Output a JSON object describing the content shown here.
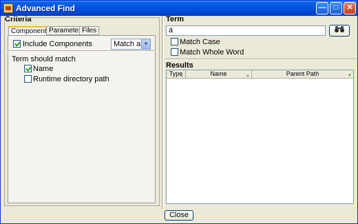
{
  "window": {
    "title": "Advanced Find",
    "buttons": {
      "minimize": "—",
      "maximize": "□",
      "close": "✕"
    }
  },
  "criteria": {
    "title": "Criteria",
    "tabs": [
      {
        "label": "Components",
        "active": true
      },
      {
        "label": "Parameters",
        "active": false
      },
      {
        "label": "Files",
        "active": false
      }
    ],
    "include_components": {
      "label": "Include Components",
      "checked": true
    },
    "match_select": {
      "value": "Match any"
    },
    "term_should_match": "Term should match",
    "options": [
      {
        "label": "Name",
        "checked": true
      },
      {
        "label": "Runtime directory path",
        "checked": false
      }
    ]
  },
  "term": {
    "title": "Term",
    "input_value": "a",
    "find_icon": "binoculars-icon",
    "match_case": {
      "label": "Match Case",
      "checked": false
    },
    "match_whole_word": {
      "label": "Match Whole Word",
      "checked": false
    }
  },
  "results": {
    "title": "Results",
    "columns": [
      "Type",
      "Name",
      "Parent Path"
    ],
    "rows": []
  },
  "footer": {
    "close_label": "Close"
  },
  "colors": {
    "title_bar": "#0453e0",
    "background": "#ece9d8",
    "active_tab_accent": "#f9b41f"
  }
}
